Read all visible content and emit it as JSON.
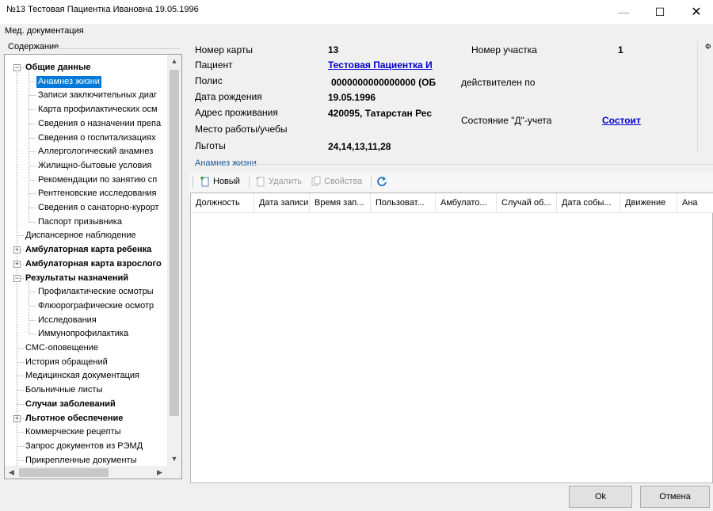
{
  "window": {
    "title": "№13 Тестовая Пациентка Ивановна 19.05.1996",
    "min_glyph": "—",
    "max_glyph": "☐",
    "close_glyph": "✕"
  },
  "menu": {
    "item": "Мед. документация"
  },
  "sidebar": {
    "title": "Содержание",
    "scroll_up": "▲",
    "scroll_down": "▼",
    "scroll_left": "◀",
    "scroll_right": "▶",
    "items": [
      {
        "label": "Общие данные",
        "bold": true,
        "expander": "−"
      },
      {
        "label": "Анамнез жизни",
        "selected": true
      },
      {
        "label": "Записи заключительных диаг"
      },
      {
        "label": "Карта профилактических осм"
      },
      {
        "label": "Сведения о назначении препа"
      },
      {
        "label": "Сведения о госпитализациях"
      },
      {
        "label": "Аллергологический анамнез"
      },
      {
        "label": "Жилищно-бытовые условия"
      },
      {
        "label": "Рекомендации по занятию сп"
      },
      {
        "label": "Рентгеновские исследования"
      },
      {
        "label": "Сведения о санаторно-курорт"
      },
      {
        "label": "Паспорт призывника"
      },
      {
        "label": "Диспансерное наблюдение"
      },
      {
        "label": "Амбулаторная карта ребенка",
        "bold": true,
        "expander": "+"
      },
      {
        "label": "Амбулаторная карта взрослого",
        "bold": true,
        "expander": "+"
      },
      {
        "label": "Результаты назначений",
        "bold": true,
        "expander": "−"
      },
      {
        "label": "Профилактические осмотры"
      },
      {
        "label": "Флюорографические осмотр"
      },
      {
        "label": "Исследования"
      },
      {
        "label": "Иммунопрофилактика"
      },
      {
        "label": "СМС-оповещение"
      },
      {
        "label": "История обращений"
      },
      {
        "label": "Медицинская документация"
      },
      {
        "label": "Больничные листы"
      },
      {
        "label": "Случаи заболеваний",
        "bold": true
      },
      {
        "label": "Льготное обеспечение",
        "bold": true,
        "expander": "+"
      },
      {
        "label": "Коммерческие рецепты"
      },
      {
        "label": "Запрос документов из РЭМД"
      },
      {
        "label": "Прикрепленные документы"
      }
    ]
  },
  "patient": {
    "card_label": "Номер карты",
    "card_value": "13",
    "patient_label": "Пациент",
    "patient_value": "Тестовая Пациентка И",
    "policy_label": "Полис",
    "policy_value": "0000000000000000 (ОБ",
    "valid_label": "действителен по",
    "birth_label": "Дата рождения",
    "birth_value": "19.05.1996",
    "address_label": "Адрес проживания",
    "address_value": "420095, Татарстан Рес",
    "work_label": "Место работы/учебы",
    "benefits_label": "Льготы",
    "benefits_value": "24,14,13,11,28",
    "district_label": "Номер участка",
    "district_value": "1",
    "d_status_label": "Состояние \"Д\"-учета",
    "d_status_value": "Состоит",
    "photo_label": "Ф"
  },
  "section": {
    "title": "Анамнез жизни"
  },
  "toolbar": {
    "new_label": "Новый",
    "delete_label": "Удалить",
    "props_label": "Свойства"
  },
  "grid": {
    "columns": [
      "Должность",
      "Дата записи",
      "Время зап...",
      "Пользоват...",
      "Амбулато...",
      "Случай об...",
      "Дата собы...",
      "Движение",
      "Ана"
    ]
  },
  "buttons": {
    "ok": "Ok",
    "cancel": "Отмена"
  }
}
